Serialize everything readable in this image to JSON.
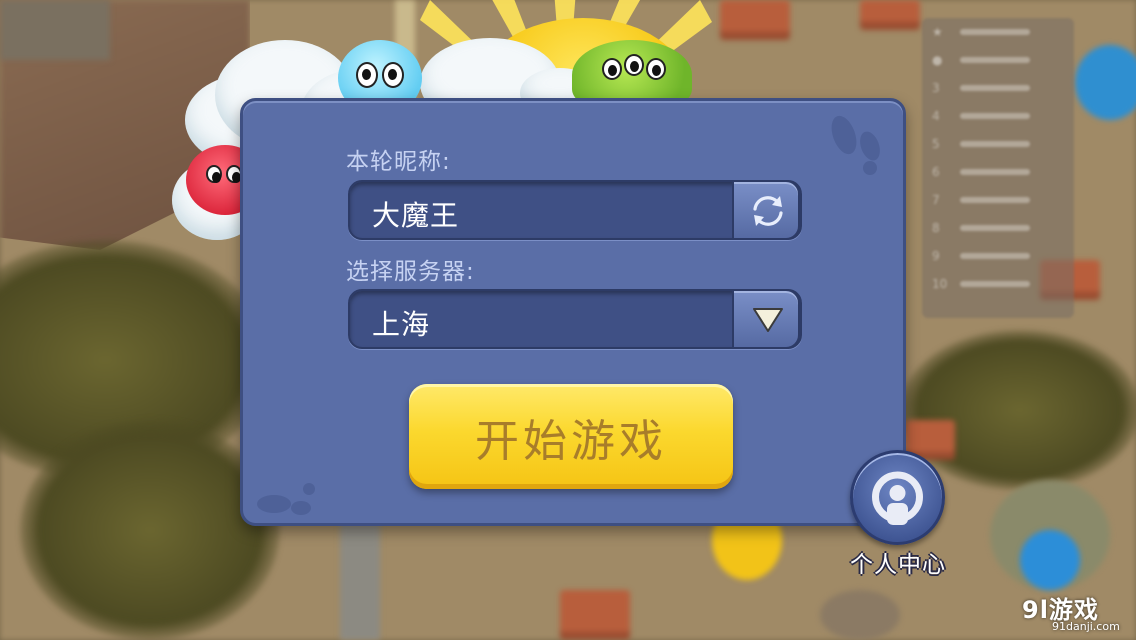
{
  "dialog": {
    "nickname_label": "本轮昵称:",
    "nickname_value": "大魔王",
    "server_label": "选择服务器:",
    "server_value": "上海",
    "start_button": "开始游戏"
  },
  "personal_center": {
    "label": "个人中心"
  },
  "watermark": {
    "logo": "9l游戏",
    "site": "91danji.com"
  },
  "icons": {
    "refresh": "refresh-icon",
    "dropdown": "triangle-down-icon",
    "personal_center": "person-icon"
  },
  "colors": {
    "dialog_bg": "#5a6ea7",
    "field_bg": "#3f5085",
    "start_button": "#fbd82e",
    "start_text": "#a87d2a"
  }
}
